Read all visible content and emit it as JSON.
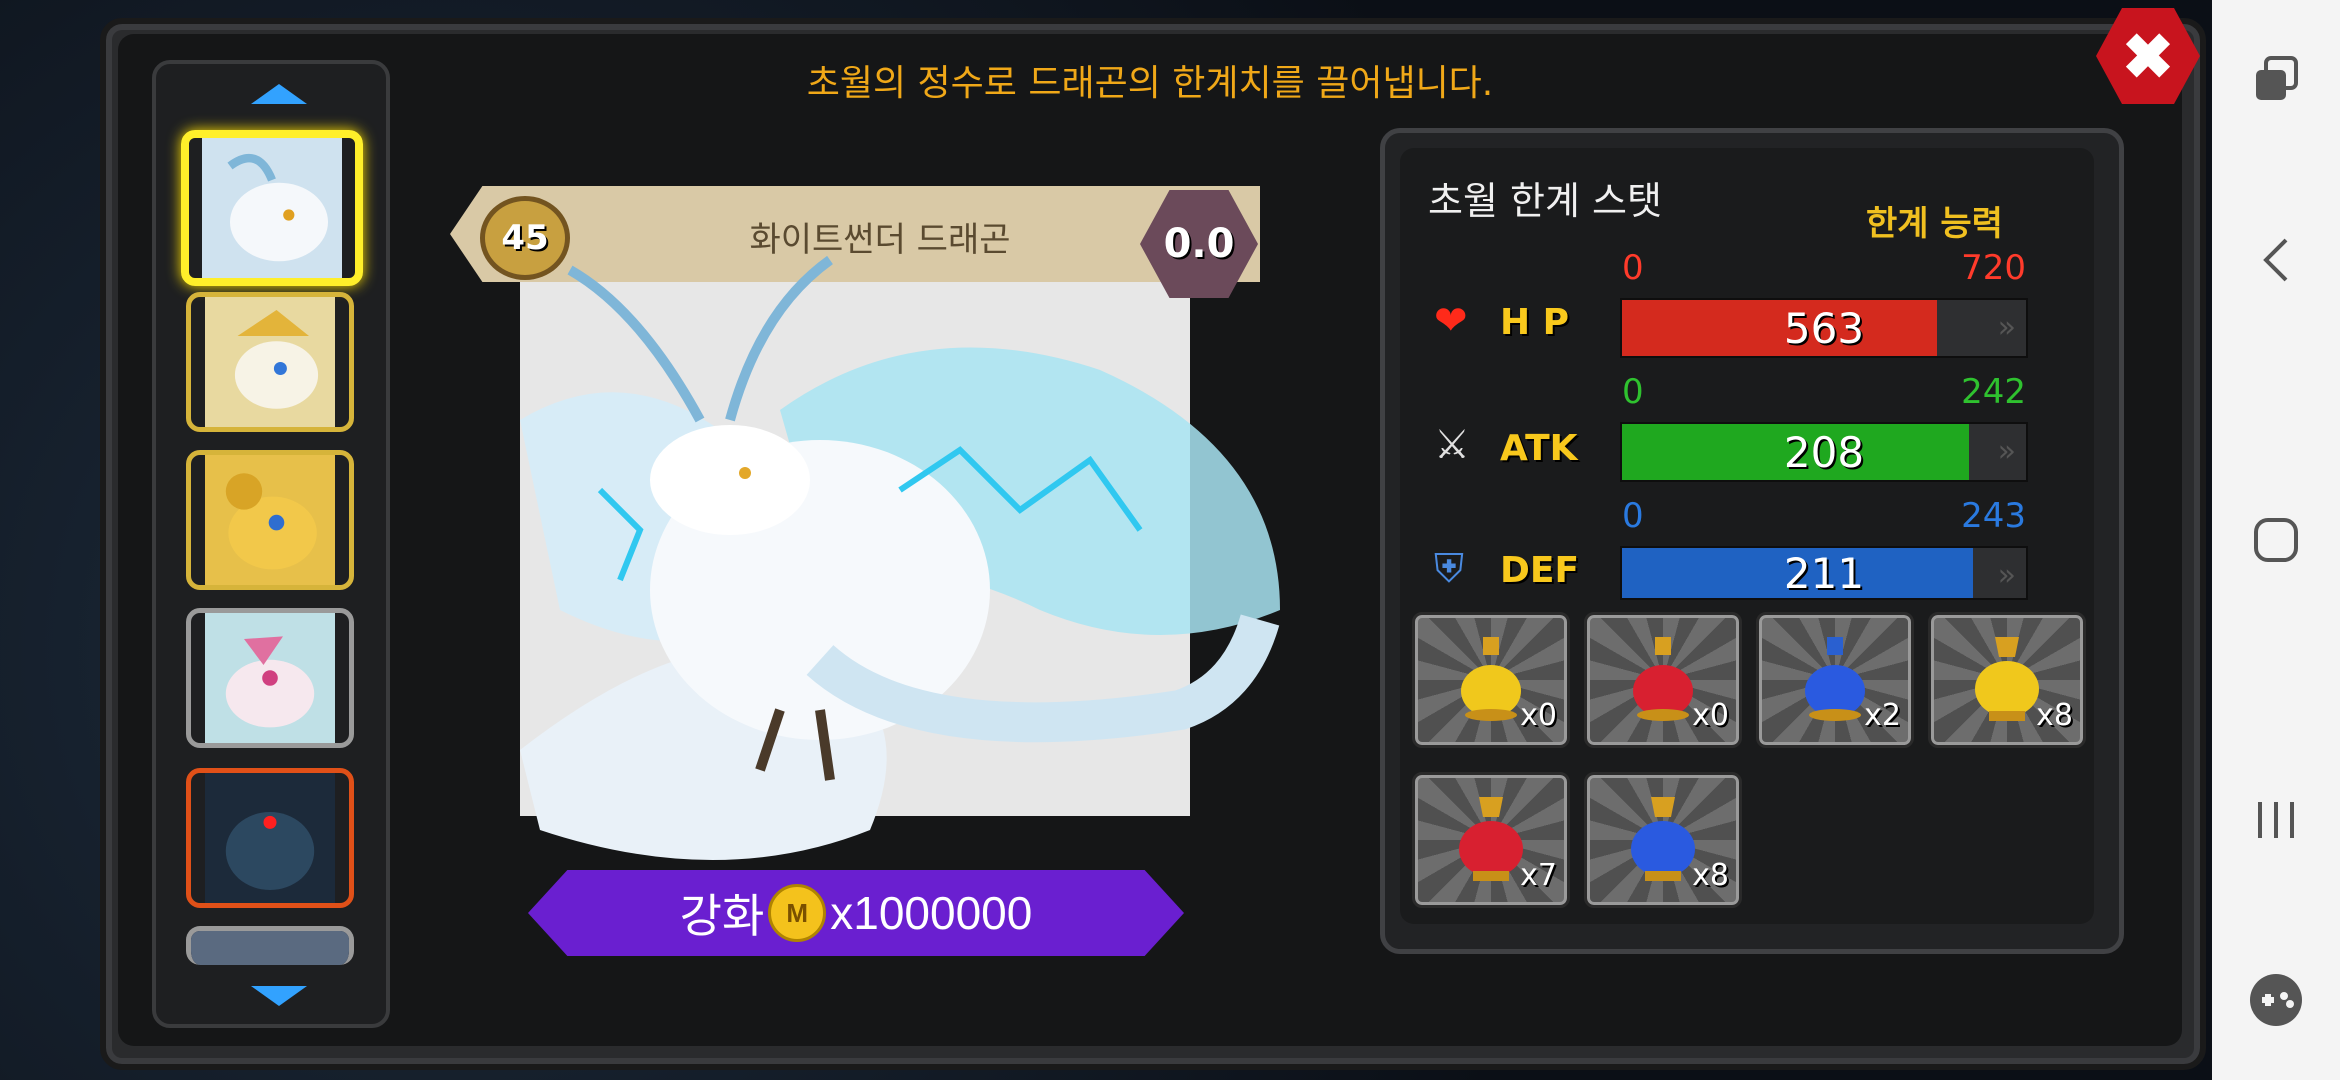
{
  "header": {
    "text": "초월의 정수로 드래곤의 한계치를 끌어냅니다.",
    "close_label": "✖"
  },
  "dragon": {
    "level": "45",
    "name": "화이트썬더 드래곤",
    "grade": "0.0"
  },
  "upgrade": {
    "label": "강화",
    "coin_symbol": "M",
    "cost": "x1000000"
  },
  "stats": {
    "title": "초월 한계 스탯",
    "limit_label": "한계 능력",
    "hp": {
      "label": "H P",
      "min": "0",
      "max": "720",
      "value": "563",
      "fraction": 0.78
    },
    "atk": {
      "label": "ATK",
      "min": "0",
      "max": "242",
      "value": "208",
      "fraction": 0.86
    },
    "def": {
      "label": "DEF",
      "min": "0",
      "max": "243",
      "value": "211",
      "fraction": 0.87
    }
  },
  "items": [
    {
      "name": "yellow-potion-icon",
      "qty": "x0"
    },
    {
      "name": "red-potion-icon",
      "qty": "x0"
    },
    {
      "name": "blue-potion-icon",
      "qty": "x2"
    },
    {
      "name": "gold-urn-icon",
      "qty": "x8"
    },
    {
      "name": "red-urn-icon",
      "qty": "x7"
    },
    {
      "name": "blue-urn-icon",
      "qty": "x8"
    }
  ],
  "colors": {
    "hp": "#d42a1e",
    "atk": "#1fa81f",
    "def": "#1f62c2",
    "accent": "#f0a818"
  }
}
